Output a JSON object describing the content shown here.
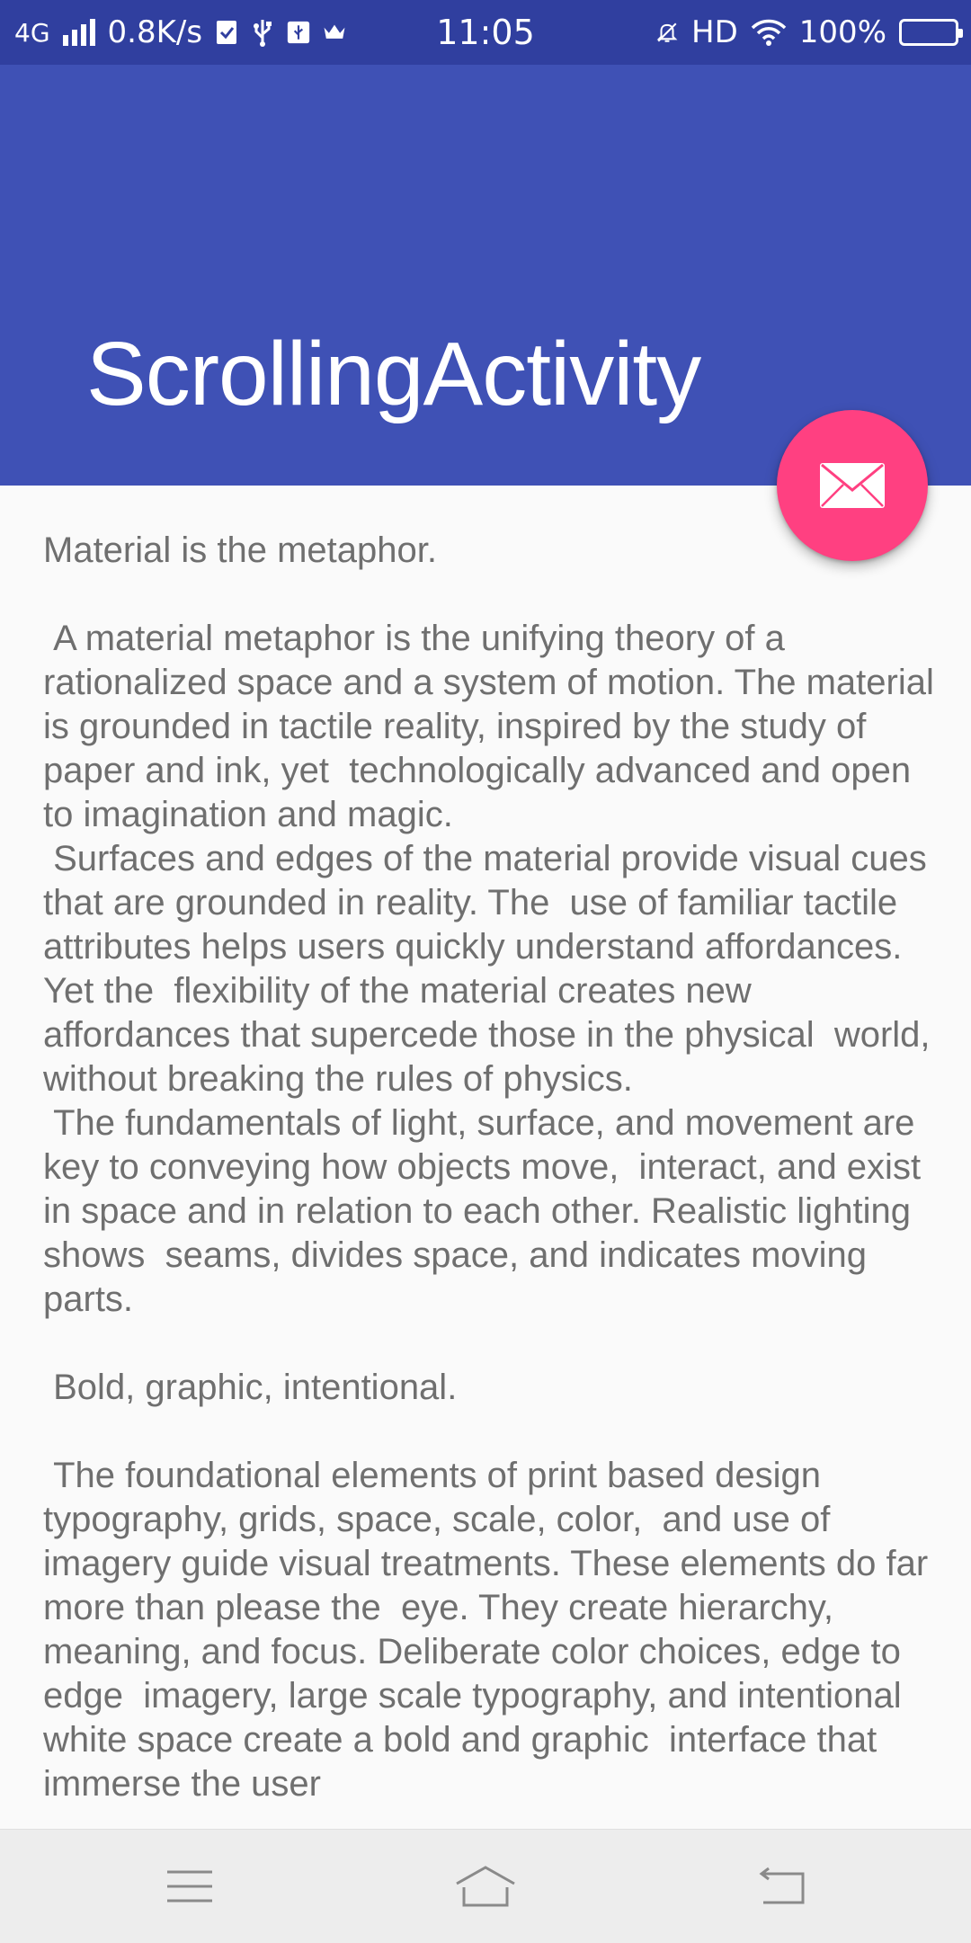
{
  "status_bar": {
    "network_type": "4G",
    "data_rate": "0.8K/s",
    "time": "11:05",
    "hd_label": "HD",
    "battery_percent": "100%",
    "battery_level": 1.0
  },
  "app_bar": {
    "title": "ScrollingActivity",
    "background_color": "#3f51b5"
  },
  "fab": {
    "icon": "email-icon",
    "color": "#ff4081"
  },
  "content": {
    "paragraphs": [
      "Material is the metaphor.\n\n A material metaphor is the unifying theory of a rationalized space and a system of motion. The material is grounded in tactile reality, inspired by the study of paper and ink, yet  technologically advanced and open to imagination and magic.\n Surfaces and edges of the material provide visual cues that are grounded in reality. The  use of familiar tactile attributes helps users quickly understand affordances. Yet the  flexibility of the material creates new affordances that supercede those in the physical  world, without breaking the rules of physics.\n The fundamentals of light, surface, and movement are key to conveying how objects move,  interact, and exist in space and in relation to each other. Realistic lighting shows  seams, divides space, and indicates moving parts.\n\n Bold, graphic, intentional.\n\n The foundational elements of print based design typography, grids, space, scale, color,  and use of imagery guide visual treatments. These elements do far more than please the  eye. They create hierarchy, meaning, and focus. Deliberate color choices, edge to edge  imagery, large scale typography, and intentional white space create a bold and graphic  interface that immerse the user"
    ]
  },
  "nav_bar": {
    "menu_icon": "menu-icon",
    "home_icon": "home-icon",
    "back_icon": "back-icon"
  }
}
